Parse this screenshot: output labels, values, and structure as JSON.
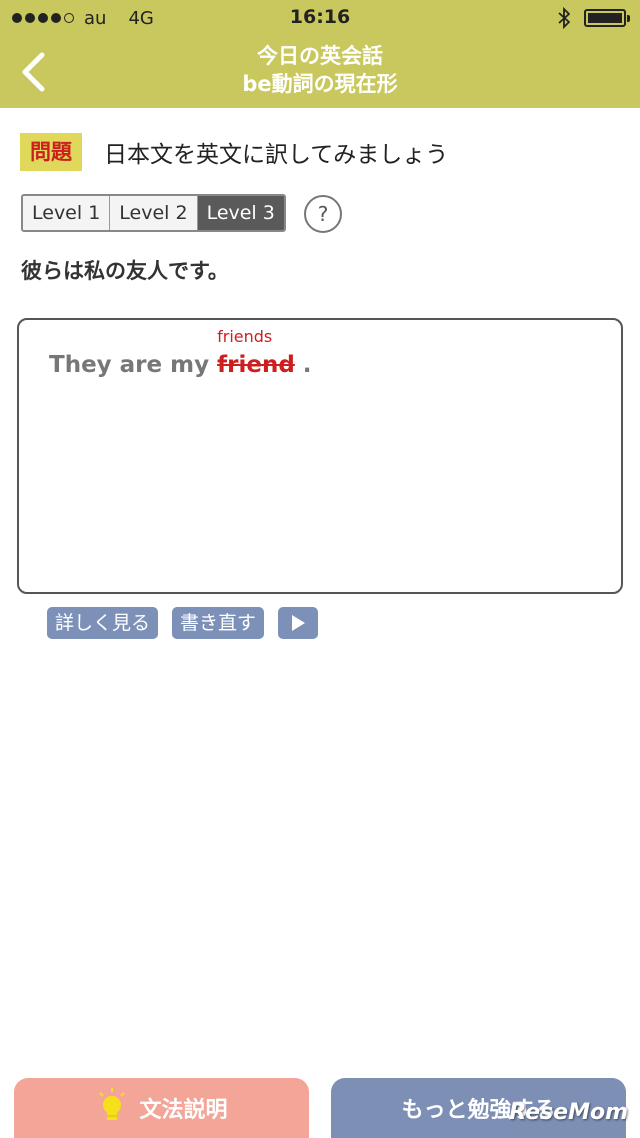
{
  "status_bar": {
    "carrier": "au",
    "network": "4G",
    "time": "16:16",
    "signal_bars_filled": 4,
    "signal_bars_total": 5
  },
  "nav": {
    "title_line1": "今日の英会話",
    "title_line2": "be動詞の現在形",
    "back_icon": "chevron-left-icon"
  },
  "question": {
    "badge": "問題",
    "instruction": "日本文を英文に訳してみましょう"
  },
  "levels": {
    "items": [
      "Level 1",
      "Level 2",
      "Level 3"
    ],
    "selected": "Level 3",
    "help_label": "?"
  },
  "sentence_jp": "彼らは私の友人です。",
  "answer": {
    "prefix": "They are my",
    "wrong_word": "friend",
    "correction": "friends",
    "suffix": "."
  },
  "actions": {
    "details_label": "詳しく見る",
    "rewrite_label": "書き直す",
    "play_icon": "play-icon"
  },
  "bottom": {
    "grammar_label": "文法説明",
    "study_more_label": "もっと勉強する"
  },
  "watermark": "ReseMom",
  "colors": {
    "header": "#c9c85e",
    "badge_bg": "#e0d85a",
    "badge_text": "#cc1f1f",
    "correction": "#cc1f1f",
    "action_button": "#7d91b8",
    "grammar_button": "#f3a598",
    "study_button": "#7d8fb5"
  }
}
